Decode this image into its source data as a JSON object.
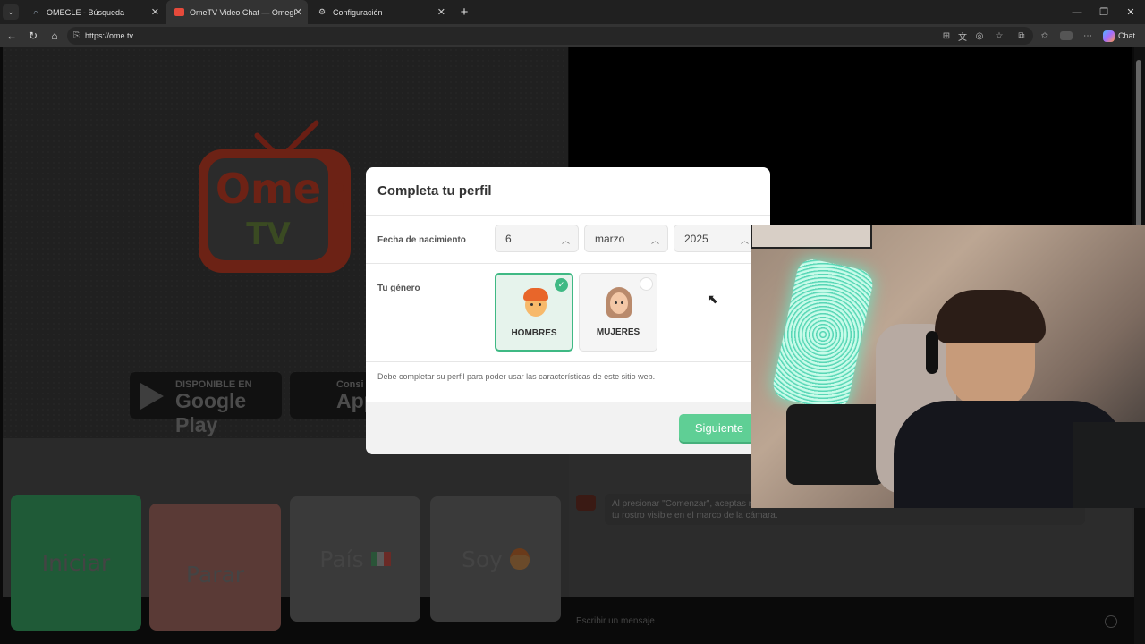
{
  "browser": {
    "tabs": [
      {
        "title": "OMEGLE - Búsqueda",
        "icon": "search-icon"
      },
      {
        "title": "OmeTV Video Chat — Omegle Ra",
        "icon": "ometv-icon"
      },
      {
        "title": "Configuración",
        "icon": "gear-icon"
      }
    ],
    "url": "https://ome.tv",
    "copilot_label": "Chat"
  },
  "landing": {
    "logo_ome": "Ome",
    "logo_tv": "TV",
    "google_play_small": "DISPONIBLE EN",
    "google_play_big": "Google Play",
    "app_store_small": "Consi",
    "app_store_big": "App"
  },
  "controls": {
    "start": "Iniciar",
    "stop": "Parar",
    "country": "País",
    "country_flag": "🇲🇽",
    "iam": "Soy",
    "iam_emoji": "👦"
  },
  "chat": {
    "message_line1": "Al presionar \"Comenzar\", aceptas n",
    "message_line2": "tu rostro visible en el marco de la cámara.",
    "input_placeholder": "Escribir un mensaje"
  },
  "modal": {
    "title": "Completa tu perfil",
    "birthdate_label": "Fecha de nacimiento",
    "day": "6",
    "month": "marzo",
    "year": "2025",
    "gender_label": "Tu género",
    "gender_male": "HOMBRES",
    "gender_female": "MUJERES",
    "selected_gender": "HOMBRES",
    "note": "Debe completar su perfil para poder usar las características de este sitio web.",
    "next_button": "Siguiente"
  },
  "colors": {
    "accent_green": "#5fcf95",
    "selected_border": "#3fb984"
  }
}
